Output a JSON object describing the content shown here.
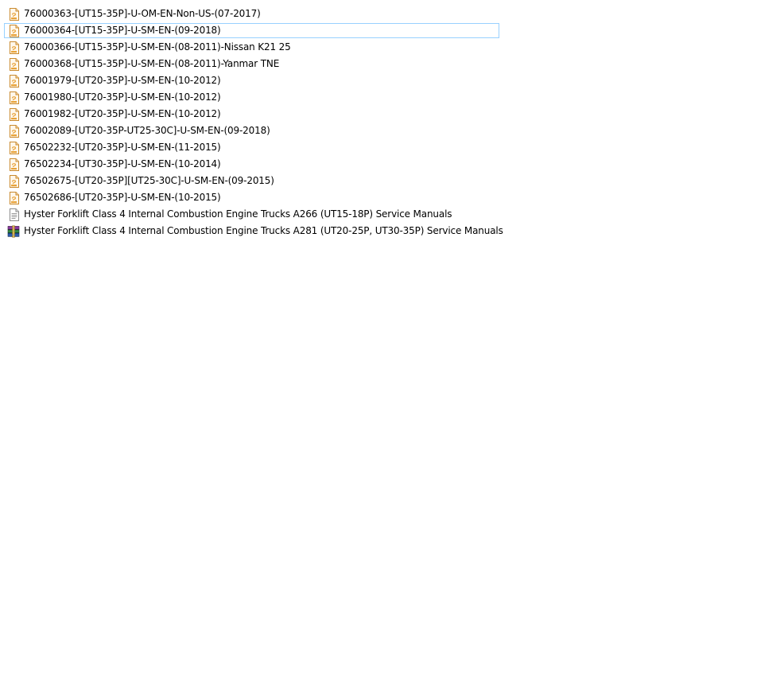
{
  "explorer": {
    "items": [
      {
        "name": "76000363-[UT15-35P]-U-OM-EN-Non-US-(07-2017)",
        "icon": "pdf-icon",
        "selected": false
      },
      {
        "name": "76000364-[UT15-35P]-U-SM-EN-(09-2018)",
        "icon": "pdf-icon",
        "selected": true
      },
      {
        "name": "76000366-[UT15-35P]-U-SM-EN-(08-2011)-Nissan K21 25",
        "icon": "pdf-icon",
        "selected": false
      },
      {
        "name": "76000368-[UT15-35P]-U-SM-EN-(08-2011)-Yanmar TNE",
        "icon": "pdf-icon",
        "selected": false
      },
      {
        "name": "76001979-[UT20-35P]-U-SM-EN-(10-2012)",
        "icon": "pdf-icon",
        "selected": false
      },
      {
        "name": "76001980-[UT20-35P]-U-SM-EN-(10-2012)",
        "icon": "pdf-icon",
        "selected": false
      },
      {
        "name": "76001982-[UT20-35P]-U-SM-EN-(10-2012)",
        "icon": "pdf-icon",
        "selected": false
      },
      {
        "name": "76002089-[UT20-35P-UT25-30C]-U-SM-EN-(09-2018)",
        "icon": "pdf-icon",
        "selected": false
      },
      {
        "name": "76502232-[UT20-35P]-U-SM-EN-(11-2015)",
        "icon": "pdf-icon",
        "selected": false
      },
      {
        "name": "76502234-[UT30-35P]-U-SM-EN-(10-2014)",
        "icon": "pdf-icon",
        "selected": false
      },
      {
        "name": "76502675-[UT20-35P][UT25-30C]-U-SM-EN-(09-2015)",
        "icon": "pdf-icon",
        "selected": false
      },
      {
        "name": "76502686-[UT20-35P]-U-SM-EN-(10-2015)",
        "icon": "pdf-icon",
        "selected": false
      },
      {
        "name": "Hyster Forklift Class 4 Internal Combustion Engine Trucks A266 (UT15-18P) Service Manuals",
        "icon": "text-document-icon",
        "selected": false
      },
      {
        "name": "Hyster Forklift Class 4 Internal Combustion Engine Trucks A281 (UT20-25P, UT30-35P) Service Manuals",
        "icon": "winrar-archive-icon",
        "selected": false
      }
    ]
  },
  "colors": {
    "selection_border": "#99d1ff",
    "pdf_icon_accent": "#e8a33a",
    "background": "#ffffff"
  }
}
